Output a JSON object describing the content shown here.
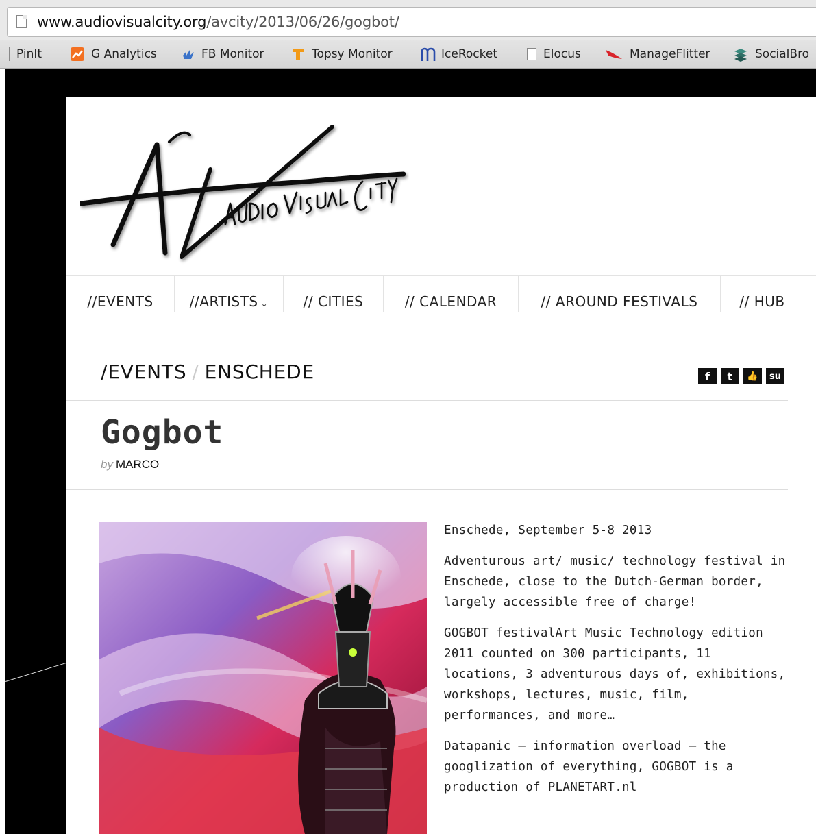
{
  "browser": {
    "url_domain": "www.audiovisualcity.org",
    "url_path": "/avcity/2013/06/26/gogbot/",
    "bookmarks": [
      {
        "label": "PinIt",
        "icon": "page-icon"
      },
      {
        "label": "G Analytics",
        "icon": "analytics-icon"
      },
      {
        "label": "FB Monitor",
        "icon": "fb-monitor-icon"
      },
      {
        "label": "Topsy Monitor",
        "icon": "topsy-icon"
      },
      {
        "label": "IceRocket",
        "icon": "icerocket-icon"
      },
      {
        "label": "Elocus",
        "icon": "page-icon"
      },
      {
        "label": "ManageFlitter",
        "icon": "manageflitter-icon"
      },
      {
        "label": "SocialBro",
        "icon": "socialbro-icon"
      }
    ]
  },
  "site": {
    "logo_text": "AUDIO VISUAL CITY",
    "nav": [
      {
        "label": "//EVENTS"
      },
      {
        "label": "//ARTISTS"
      },
      {
        "label": "// CITIES"
      },
      {
        "label": "// CALENDAR"
      },
      {
        "label": "// AROUND FESTIVALS"
      },
      {
        "label": "// HUB"
      }
    ],
    "caret": "⌄"
  },
  "breadcrumb": {
    "section": "/EVENTS",
    "separator": "/",
    "current": "ENSCHEDE"
  },
  "share": [
    {
      "label": "f",
      "icon": "facebook-icon"
    },
    {
      "label": "t",
      "icon": "twitter-icon"
    },
    {
      "label": "👍",
      "icon": "like-icon"
    },
    {
      "label": "su",
      "icon": "stumbleupon-icon"
    }
  ],
  "post": {
    "title": "Gogbot",
    "by_label": "by",
    "author": "MARCO",
    "paragraphs": [
      "Enschede, September 5-8 2013",
      "Adventurous art/ music/ technology festival in Enschede, close to the Dutch-German border, largely accessible free of charge!",
      "GOGBOT festivalArt Music Technology edition 2011 counted on 300 participants, 11 locations, 3 adventurous days of, exhibitions, workshops, lectures, music, film, performances, and more…",
      "Datapanic – information overload – the googlization of everything, GOGBOT is a production of PLANETART.nl"
    ]
  }
}
